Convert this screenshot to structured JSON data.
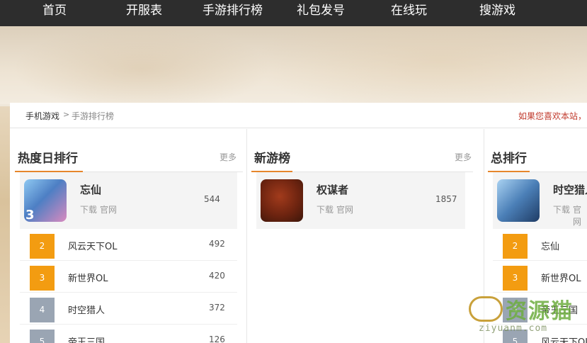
{
  "nav": [
    {
      "label": "首页"
    },
    {
      "label": "开服表"
    },
    {
      "label": "手游排行榜"
    },
    {
      "label": "礼包发号"
    },
    {
      "label": "在线玩"
    },
    {
      "label": "搜游戏"
    }
  ],
  "breadcrumb": {
    "home": "手机游戏",
    "separator": ">",
    "current": "手游排行榜"
  },
  "notice": "如果您喜欢本站，",
  "panels": {
    "hot": {
      "title": "热度日排行",
      "more": "更多",
      "top": {
        "rank": "3",
        "name": "忘仙",
        "download": "下载",
        "official": "官网",
        "score": "544",
        "icon": "game-icon-wangxian"
      },
      "rows": [
        {
          "rank": "2",
          "name": "风云天下OL",
          "score": "492"
        },
        {
          "rank": "3",
          "name": "新世界OL",
          "score": "420"
        },
        {
          "rank": "4",
          "name": "时空猎人",
          "score": "372"
        },
        {
          "rank": "5",
          "name": "帝王三国",
          "score": "126"
        }
      ]
    },
    "new": {
      "title": "新游榜",
      "more": "更多",
      "top": {
        "name": "权谋者",
        "download": "下载",
        "official": "官网",
        "score": "1857",
        "icon": "game-icon-quanmouzhe"
      }
    },
    "total": {
      "title": "总排行",
      "top": {
        "name": "时空猎人",
        "download": "下载",
        "official": "官网",
        "icon": "game-icon-shikonglieren"
      },
      "rows": [
        {
          "rank": "2",
          "name": "忘仙"
        },
        {
          "rank": "3",
          "name": "新世界OL"
        },
        {
          "rank": "4",
          "name": "帝王三国"
        },
        {
          "rank": "5",
          "name": "风云天下OL"
        }
      ]
    }
  },
  "watermark": {
    "text": "资源猫",
    "domain": "ziyuanm.com"
  },
  "colors": {
    "nav_bg": "#2d2d2d",
    "accent": "#e6862b",
    "badge_orange": "#f39c11",
    "badge_gray": "#9aa5b3",
    "notice": "#c0392b"
  }
}
